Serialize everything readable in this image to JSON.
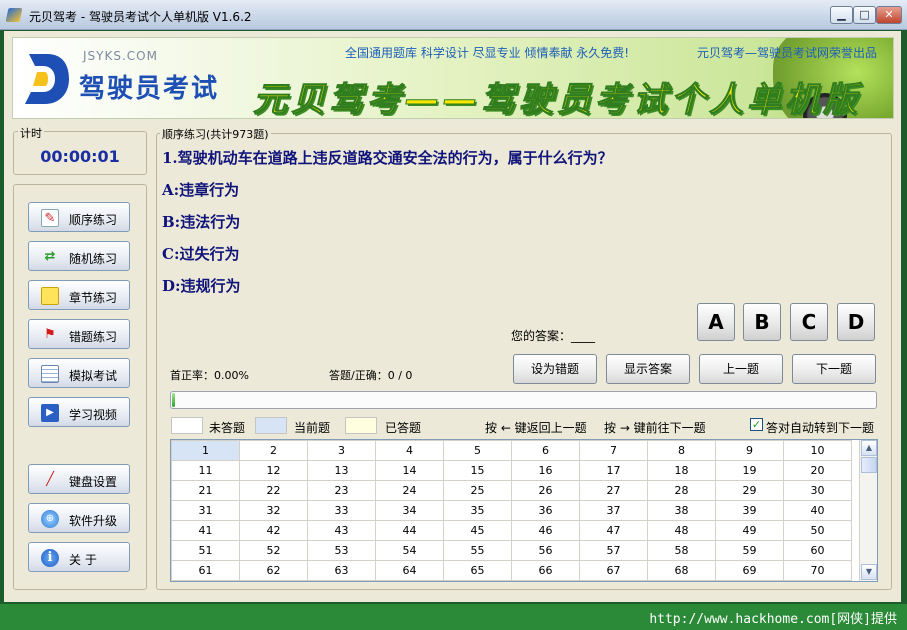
{
  "window": {
    "title": "元贝驾考 - 驾驶员考试个人单机版 V1.6.2",
    "min_label": "▁",
    "max_label": "□",
    "close_label": "✕"
  },
  "banner": {
    "logo_url": "JSYKS.COM",
    "logo_text": "驾驶员考试",
    "slogan": "全国通用题库 科学设计 尽显专业 倾情奉献 永久免费!",
    "credit": "元贝驾考—驾驶员考试网荣誉出品",
    "big_title": "元贝驾考——驾驶员考试个人单机版"
  },
  "timer": {
    "label": "计时",
    "value": "00:00:01"
  },
  "nav": [
    {
      "label": "顺序练习",
      "icon": "pencil-notepad-icon"
    },
    {
      "label": "随机练习",
      "icon": "refresh-arrows-icon"
    },
    {
      "label": "章节练习",
      "icon": "sticky-note-icon"
    },
    {
      "label": "错题练习",
      "icon": "red-flag-icon"
    },
    {
      "label": "模拟考试",
      "icon": "calendar-icon"
    },
    {
      "label": "学习视频",
      "icon": "play-video-icon"
    },
    {
      "label": "键盘设置",
      "icon": "brush-icon"
    },
    {
      "label": "软件升级",
      "icon": "globe-search-icon"
    },
    {
      "label": "关 于",
      "icon": "info-icon"
    }
  ],
  "main": {
    "legend": "顺序练习(共计973题)",
    "question": "1.驾驶机动车在道路上违反道路交通安全法的行为，属于什么行为？",
    "options": [
      "A:违章行为",
      "B:违法行为",
      "C:过失行为",
      "D:违规行为"
    ],
    "your_answer": "您的答案：____",
    "answer_buttons": [
      "A",
      "B",
      "C",
      "D"
    ],
    "rate": "首正率：0.00%",
    "count": "答题/正确：0 / 0",
    "actions": [
      "设为错题",
      "显示答案",
      "上一题",
      "下一题"
    ],
    "progress_fraction": 0.003
  },
  "legend": {
    "unanswered": "未答题",
    "current": "当前题",
    "answered": "已答题",
    "colors": {
      "unanswered": "#ffffff",
      "current": "#d6e4f5",
      "answered": "#ffffe0"
    }
  },
  "hints": {
    "prev": "按 ← 键返回上一题",
    "next": "按 → 键前往下一题",
    "auto_next": "答对自动转到下一题",
    "auto_next_checked": true
  },
  "grid": {
    "rows": [
      [
        1,
        2,
        3,
        4,
        5,
        6,
        7,
        8,
        9,
        10
      ],
      [
        11,
        12,
        13,
        14,
        15,
        16,
        17,
        18,
        19,
        20
      ],
      [
        21,
        22,
        23,
        24,
        25,
        26,
        27,
        28,
        29,
        30
      ],
      [
        31,
        32,
        33,
        34,
        35,
        36,
        37,
        38,
        39,
        40
      ],
      [
        41,
        42,
        43,
        44,
        45,
        46,
        47,
        48,
        49,
        50
      ],
      [
        51,
        52,
        53,
        54,
        55,
        56,
        57,
        58,
        59,
        60
      ],
      [
        61,
        62,
        63,
        64,
        65,
        66,
        67,
        68,
        69,
        70
      ]
    ],
    "current": 1
  },
  "statusbar": {
    "text": "http://www.hackhome.com[网侠]提供"
  }
}
